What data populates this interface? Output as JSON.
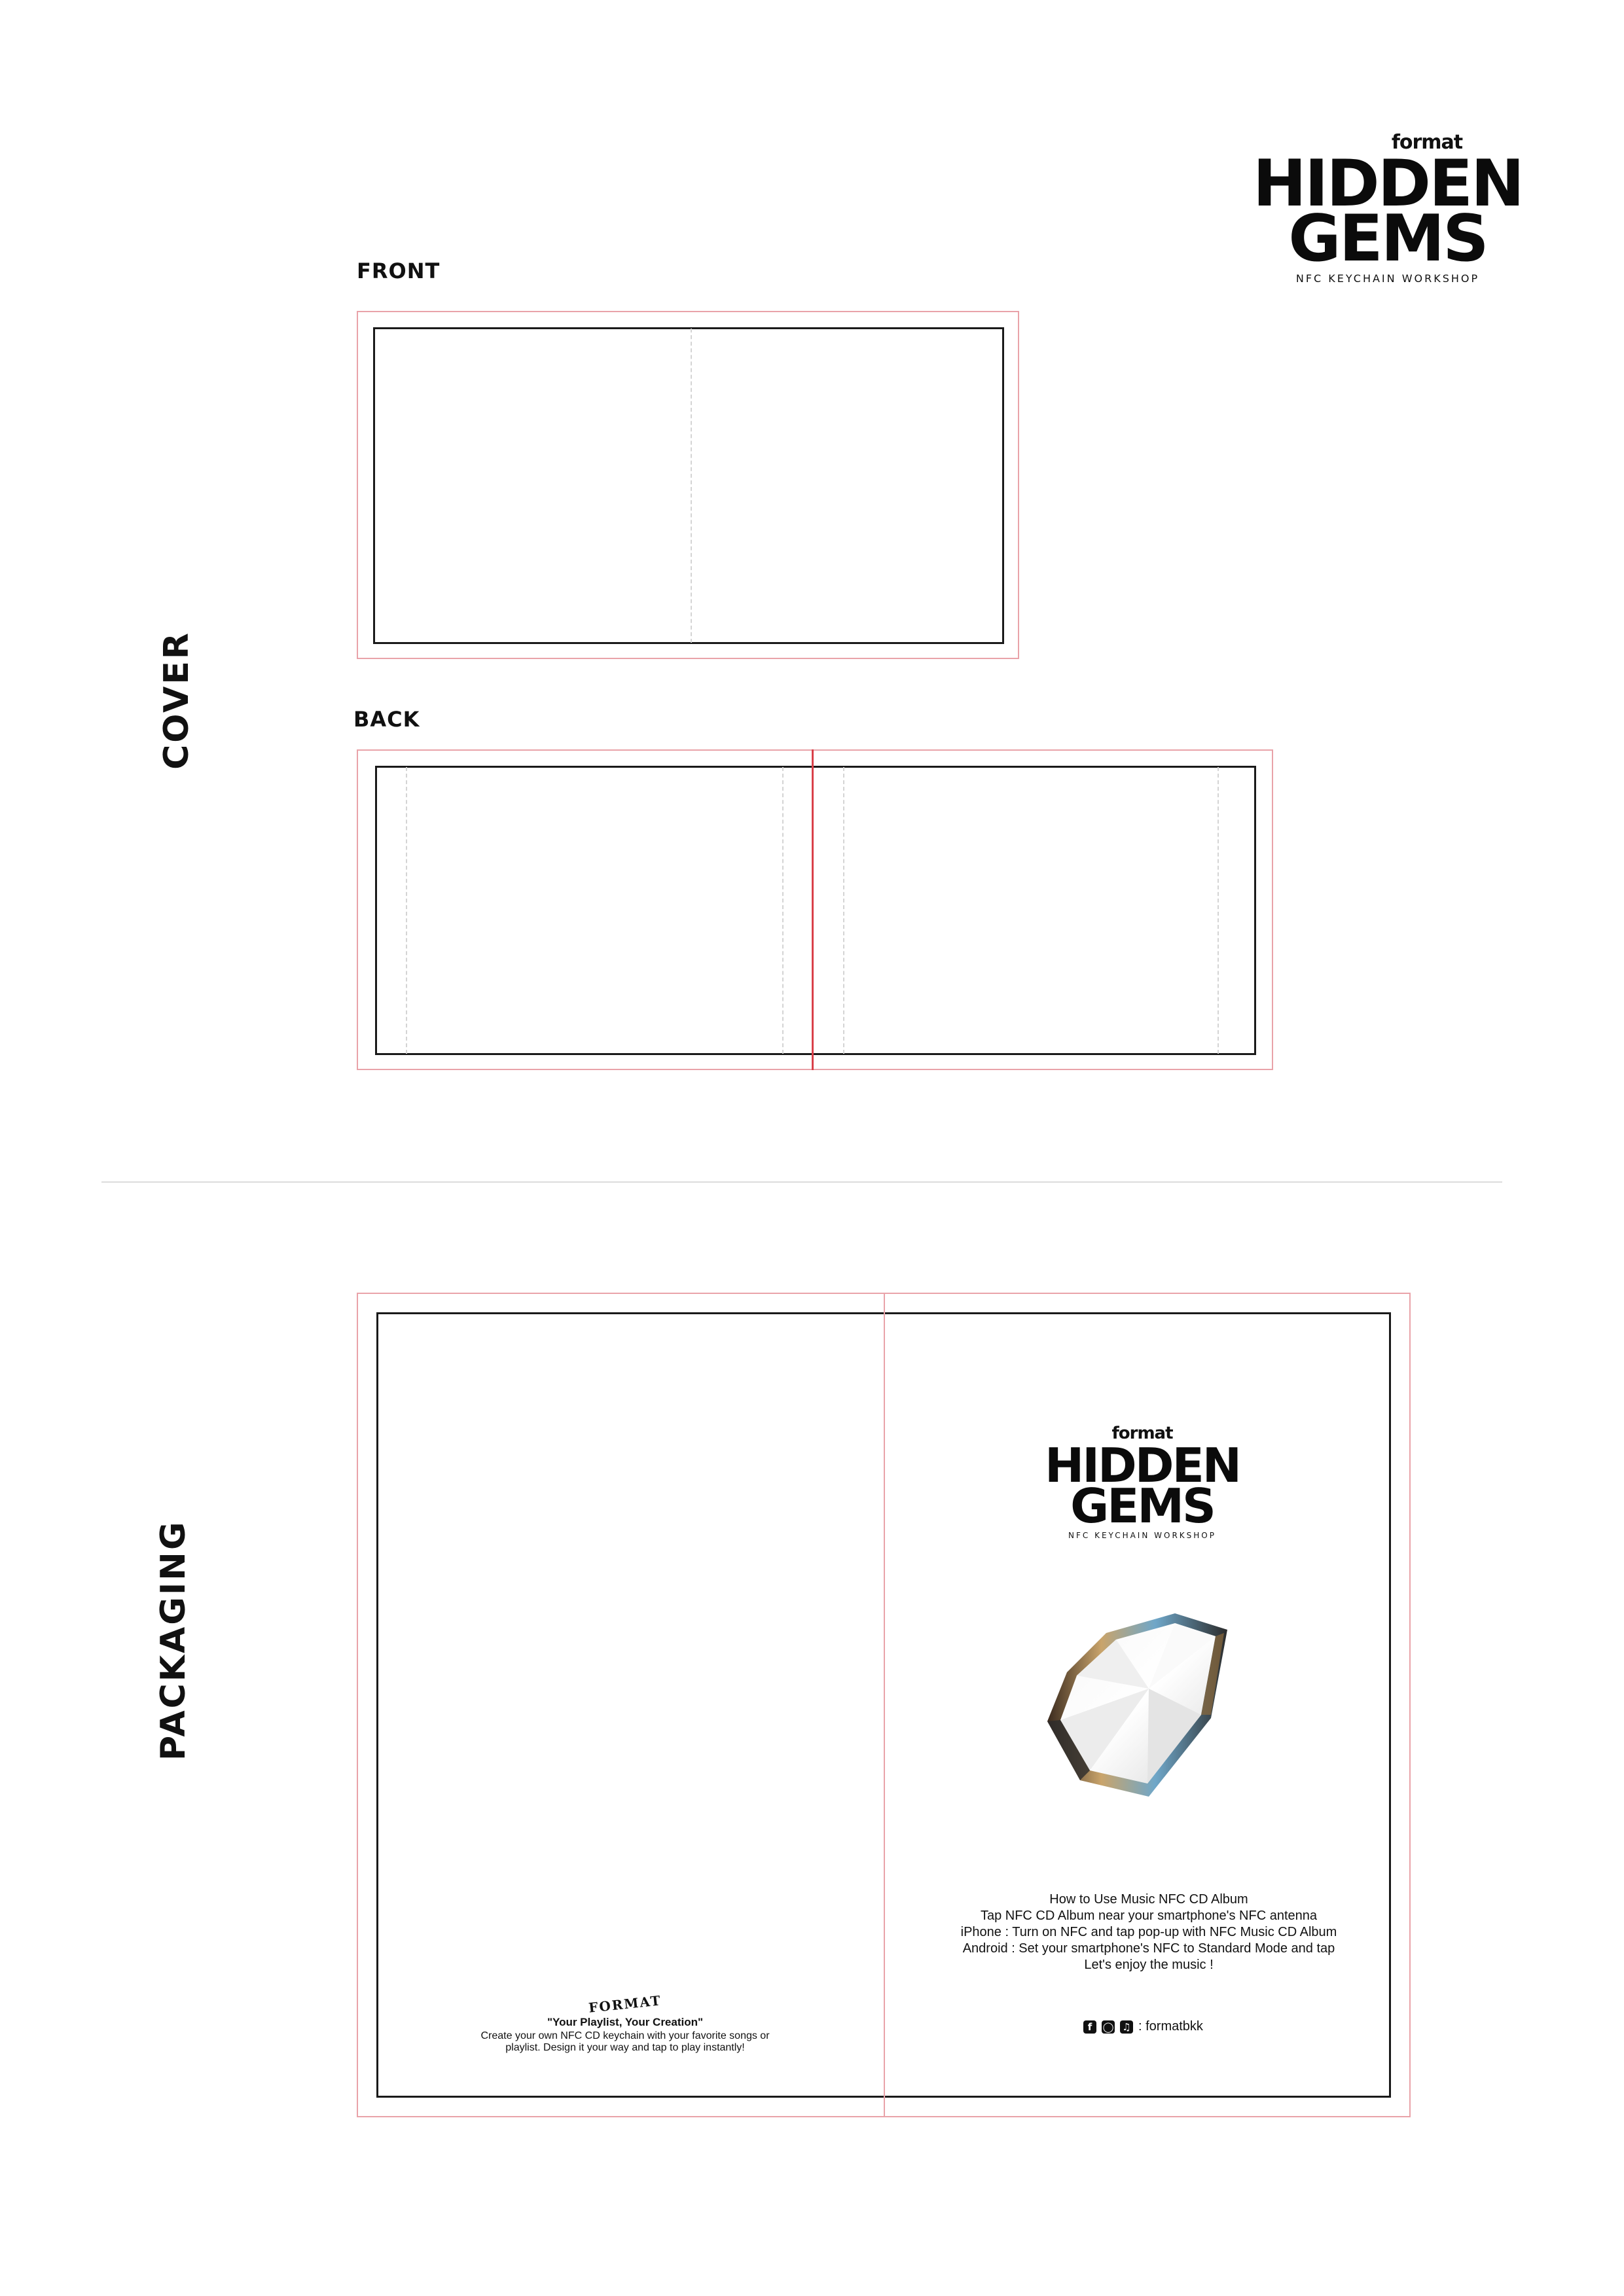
{
  "header_logo": {
    "brand": "format",
    "title_line1": "HIDDEN",
    "title_line2": "GEMS",
    "subtitle": "NFC KEYCHAIN WORKSHOP"
  },
  "cover": {
    "section_label": "COVER",
    "front_label": "FRONT",
    "back_label": "BACK"
  },
  "packaging": {
    "section_label": "PACKAGING",
    "logo": {
      "brand": "format",
      "title_line1": "HIDDEN",
      "title_line2": "GEMS",
      "subtitle": "NFC KEYCHAIN WORKSHOP"
    },
    "instructions": [
      "How to Use Music NFC CD Album",
      "Tap NFC CD Album near your smartphone's NFC antenna",
      "iPhone : Turn on NFC and tap pop-up with NFC Music CD Album",
      "Android : Set your smartphone's NFC to Standard Mode and tap",
      "Let's enjoy the music !"
    ],
    "social": {
      "icons": [
        "facebook-icon",
        "instagram-icon",
        "tiktok-icon"
      ],
      "handle": ": formatbkk"
    },
    "back_panel": {
      "brand_mark": "FORMAT",
      "headline": "\"Your Playlist, Your Creation\"",
      "body_line1": "Create your own NFC CD keychain with your favorite songs or",
      "body_line2": "playlist. Design it your way and tap to play instantly!"
    }
  },
  "colors": {
    "bleed_line": "#e9a3a9",
    "spine_line": "#d9414a",
    "trim_line": "#1a1a1a",
    "fold_line": "#d4d4d4"
  }
}
